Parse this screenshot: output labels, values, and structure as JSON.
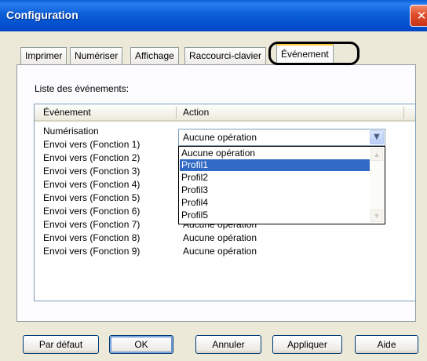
{
  "window": {
    "title": "Configuration",
    "close_icon": "close-icon"
  },
  "tabs": [
    {
      "label": "Imprimer"
    },
    {
      "label": "Numériser"
    },
    {
      "label": "Affichage"
    },
    {
      "label": "Raccourci-clavier"
    },
    {
      "label": "Événement",
      "active": true
    }
  ],
  "events_label": "Liste des événements:",
  "list": {
    "columns": [
      "Événement",
      "Action"
    ],
    "rows": [
      {
        "event": "Numérisation",
        "action": "Aucune opération"
      },
      {
        "event": "Envoi vers (Fonction 1)",
        "action": ""
      },
      {
        "event": "Envoi vers (Fonction 2)",
        "action": ""
      },
      {
        "event": "Envoi vers (Fonction 3)",
        "action": ""
      },
      {
        "event": "Envoi vers (Fonction 4)",
        "action": ""
      },
      {
        "event": "Envoi vers (Fonction 5)",
        "action": ""
      },
      {
        "event": "Envoi vers (Fonction 6)",
        "action": ""
      },
      {
        "event": "Envoi vers (Fonction 7)",
        "action": "Aucune opération"
      },
      {
        "event": "Envoi vers (Fonction 8)",
        "action": "Aucune opération"
      },
      {
        "event": "Envoi vers (Fonction 9)",
        "action": "Aucune opération"
      }
    ]
  },
  "combo": {
    "value": "Aucune opération",
    "options": [
      "Aucune opération",
      "Profil1",
      "Profil2",
      "Profil3",
      "Profil4",
      "Profil5"
    ],
    "highlighted": "Profil1"
  },
  "buttons": {
    "default": "Par défaut",
    "ok": "OK",
    "cancel": "Annuler",
    "apply": "Appliquer",
    "help": "Aide"
  },
  "colors": {
    "titlebar": "#0a5fd6",
    "selection": "#316ac5",
    "active_tab_accent": "#ffc83c"
  }
}
